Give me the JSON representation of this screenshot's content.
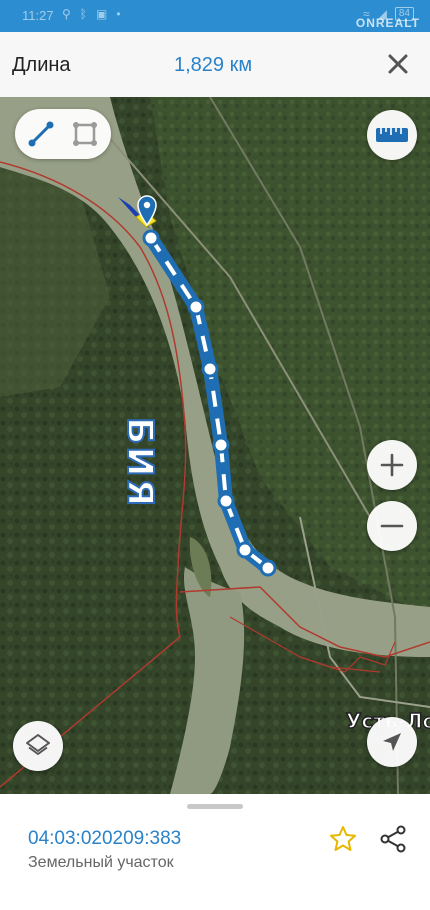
{
  "status": {
    "time": "11:27",
    "battery": "84",
    "watermark": "ONREALT",
    "left_icons": [
      "location-icon",
      "bluetooth-icon",
      "image-icon",
      "dot-icon"
    ],
    "right_icons": [
      "wifi-icon",
      "signal-icon",
      "battery-icon"
    ]
  },
  "measure": {
    "label": "Длина",
    "value": "1,829 км"
  },
  "map": {
    "river_label": "БИЯ",
    "place_label": "Усть-Ло",
    "route_color": "#1f6eb3",
    "route_point_count": 8,
    "boundary_color": "#c0392b"
  },
  "controls": {
    "mode_options": [
      "line-icon",
      "polygon-icon"
    ],
    "ruler_icon": "ruler-icon",
    "zoom_in_icon": "plus-icon",
    "zoom_out_icon": "minus-icon",
    "layers_icon": "layers-icon",
    "locate_icon": "navigation-arrow-icon"
  },
  "parcel": {
    "cadastral_number": "04:03:020209:383",
    "type": "Земельный участок",
    "star_color": "#e6b800",
    "accent": "#2a82c8"
  }
}
